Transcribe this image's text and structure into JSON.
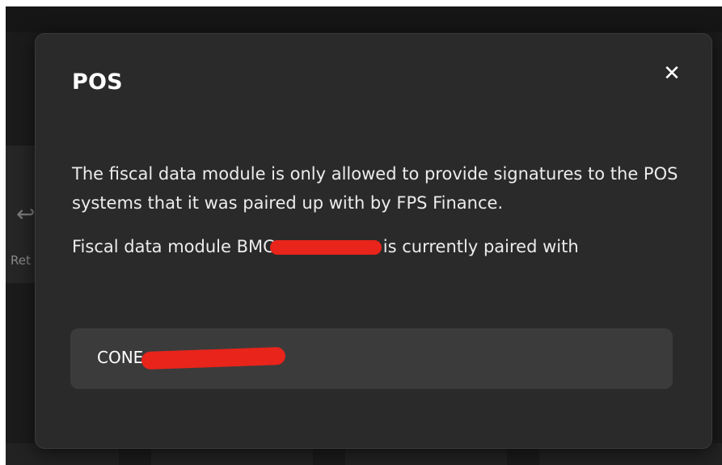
{
  "background": {
    "left_label": "Ret"
  },
  "modal": {
    "title": "POS",
    "close_icon": "close-icon",
    "paragraph1": "The fiscal data module is only allowed to provide signatures to the POS systems that it was paired up with by FPS Finance.",
    "paragraph2_prefix": "Fiscal data module BMC",
    "paragraph2_suffix": "is currently paired with",
    "paired_pos": "CONE"
  },
  "colors": {
    "modal_bg": "#2a2a2a",
    "item_bg": "#3b3b3b",
    "redaction": "#e8241b"
  }
}
